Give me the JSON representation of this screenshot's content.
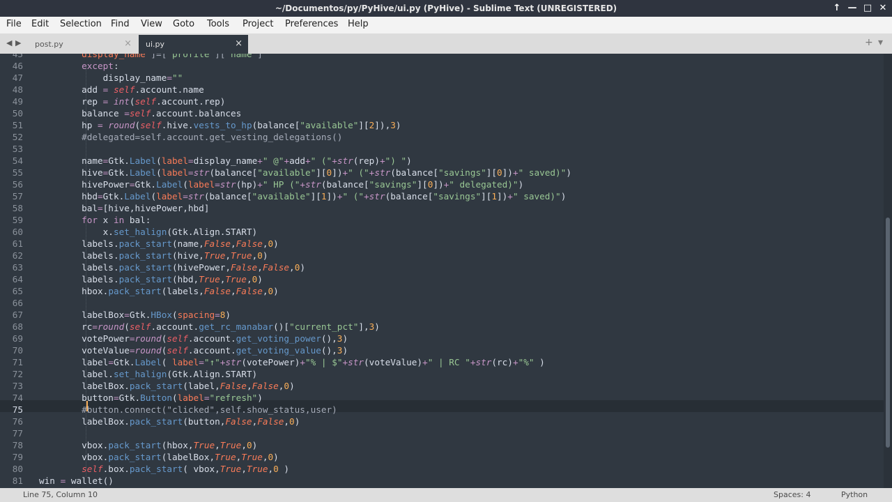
{
  "window": {
    "title": "~/Documentos/py/PyHive/ui.py (PyHive) - Sublime Text (UNREGISTERED)",
    "controls": {
      "up": "↑",
      "minimize": "—",
      "maximize": "□",
      "close": "✕"
    }
  },
  "menu": [
    "File",
    "Edit",
    "Selection",
    "Find",
    "View",
    "Goto",
    "Tools",
    "Project",
    "Preferences",
    "Help"
  ],
  "tabs": [
    {
      "label": "post.py",
      "close": "×"
    },
    {
      "label": "ui.py",
      "close": "×"
    }
  ],
  "tabbar": {
    "back": "◀",
    "forward": "▶",
    "new_tab": "+",
    "tab_menu": "▾"
  },
  "editor": {
    "first_partial_line": "45",
    "last_partial_line": "82",
    "current_line": "75",
    "lines": [
      {
        "n": "46",
        "t": "        except:"
      },
      {
        "n": "47",
        "t": "            display_name=\"\""
      },
      {
        "n": "48",
        "t": "        add = self.account.name"
      },
      {
        "n": "49",
        "t": "        rep = int(self.account.rep)"
      },
      {
        "n": "50",
        "t": "        balance =self.account.balances"
      },
      {
        "n": "51",
        "t": "        hp = round(self.hive.vests_to_hp(balance[\"available\"][2]),3)"
      },
      {
        "n": "52",
        "t": "        #delegated=self.account.get_vesting_delegations()"
      },
      {
        "n": "53",
        "t": ""
      },
      {
        "n": "54",
        "t": "        name=Gtk.Label(label=display_name+\" @\"+add+\" (\"+str(rep)+\") \")"
      },
      {
        "n": "55",
        "t": "        hive=Gtk.Label(label=str(balance[\"available\"][0])+\" (\"+str(balance[\"savings\"][0])+\" saved)\")"
      },
      {
        "n": "56",
        "t": "        hivePower=Gtk.Label(label=str(hp)+\" HP (\"+str(balance[\"savings\"][0])+\" delegated)\")"
      },
      {
        "n": "57",
        "t": "        hbd=Gtk.Label(label=str(balance[\"available\"][1])+\" (\"+str(balance[\"savings\"][1])+\" saved)\")"
      },
      {
        "n": "58",
        "t": "        bal=[hive,hivePower,hbd]"
      },
      {
        "n": "59",
        "t": "        for x in bal:"
      },
      {
        "n": "60",
        "t": "            x.set_halign(Gtk.Align.START)"
      },
      {
        "n": "61",
        "t": "        labels.pack_start(name,False,False,0)"
      },
      {
        "n": "62",
        "t": "        labels.pack_start(hive,True,True,0)"
      },
      {
        "n": "63",
        "t": "        labels.pack_start(hivePower,False,False,0)"
      },
      {
        "n": "64",
        "t": "        labels.pack_start(hbd,True,True,0)"
      },
      {
        "n": "65",
        "t": "        hbox.pack_start(labels,False,False,0)"
      },
      {
        "n": "66",
        "t": ""
      },
      {
        "n": "67",
        "t": "        labelBox=Gtk.HBox(spacing=8)"
      },
      {
        "n": "68",
        "t": "        rc=round(self.account.get_rc_manabar()[\"current_pct\"],3)"
      },
      {
        "n": "69",
        "t": "        votePower=round(self.account.get_voting_power(),3)"
      },
      {
        "n": "70",
        "t": "        voteValue=round(self.account.get_voting_value(),3)"
      },
      {
        "n": "71",
        "t": "        label=Gtk.Label( label=\"↑\"+str(votePower)+\"% | $\"+str(voteValue)+\" | RC \"+str(rc)+\"%\" )"
      },
      {
        "n": "72",
        "t": "        label.set_halign(Gtk.Align.START)"
      },
      {
        "n": "73",
        "t": "        labelBox.pack_start(label,False,False,0)"
      },
      {
        "n": "74",
        "t": "        button=Gtk.Button(label=\"refresh\")"
      },
      {
        "n": "75",
        "t": "        #button.connect(\"clicked\",self.show_status,user)"
      },
      {
        "n": "76",
        "t": "        labelBox.pack_start(button,False,False,0)"
      },
      {
        "n": "77",
        "t": ""
      },
      {
        "n": "78",
        "t": "        vbox.pack_start(hbox,True,True,0)"
      },
      {
        "n": "79",
        "t": "        vbox.pack_start(labelBox,True,True,0)"
      },
      {
        "n": "80",
        "t": "        self.box.pack_start( vbox,True,True,0 )"
      },
      {
        "n": "81",
        "t": "win = wallet()"
      }
    ]
  },
  "status": {
    "position": "Line 75, Column 10",
    "indent": "Spaces: 4",
    "syntax": "Python"
  },
  "colors": {
    "editor_bg": "#303841",
    "keyword": "#c695c6",
    "function": "#6699cc",
    "string": "#99c794",
    "number": "#f9ae58",
    "comment": "#a6acb9"
  }
}
